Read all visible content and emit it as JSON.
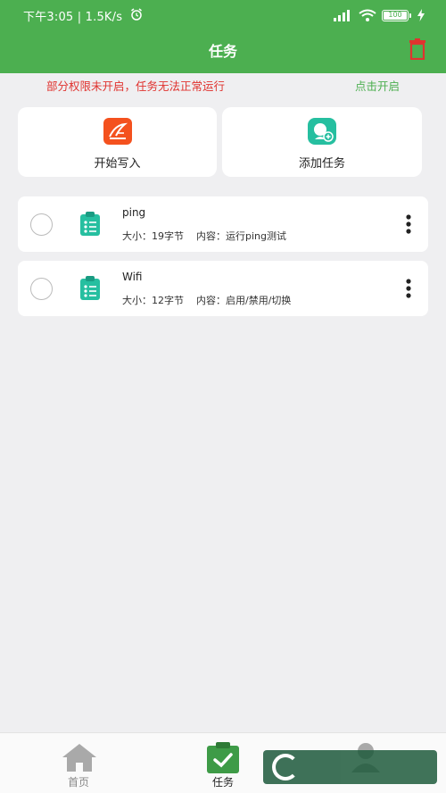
{
  "status_bar": {
    "time": "下午3:05",
    "speed": "1.5K/s",
    "battery": "100"
  },
  "header": {
    "title": "任务"
  },
  "permission": {
    "message": "部分权限未开启，任务无法正常运行",
    "action": "点击开启"
  },
  "actions": [
    {
      "label": "开始写入",
      "icon": "write-icon",
      "color": "#f4511e"
    },
    {
      "label": "添加任务",
      "icon": "add-task-icon",
      "color": "#26bfa0"
    }
  ],
  "tasks": [
    {
      "name": "ping",
      "size_label": "大小：",
      "size": "19字节",
      "content_label": "内容：",
      "content": "运行ping测试"
    },
    {
      "name": "Wifi",
      "size_label": "大小：",
      "size": "12字节",
      "content_label": "内容：",
      "content": "启用/禁用/切换"
    }
  ],
  "tabbar": {
    "items": [
      {
        "label": "首页",
        "icon": "home-icon"
      },
      {
        "label": "任务",
        "icon": "task-icon",
        "active": true
      },
      {
        "label": "",
        "icon": "profile-icon"
      }
    ]
  },
  "colors": {
    "primary": "#4caf50",
    "warning": "#e0332f",
    "background": "#efeff1"
  }
}
